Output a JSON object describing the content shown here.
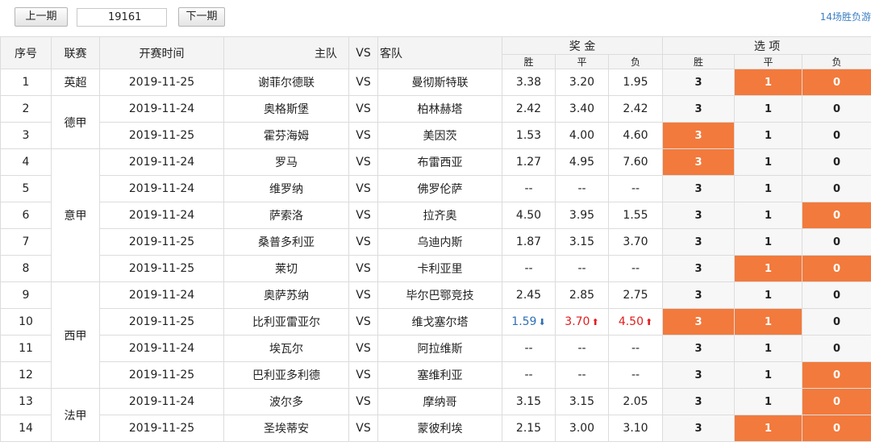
{
  "controls": {
    "prev_label": "上一期",
    "period_value": "19161",
    "next_label": "下一期",
    "top_link": "14场胜负游"
  },
  "headers": {
    "index": "序号",
    "league": "联赛",
    "time": "开赛时间",
    "home": "主队",
    "vs": "VS",
    "away": "客队",
    "prize_group": "奖 金",
    "options_group": "选 项",
    "win": "胜",
    "draw": "平",
    "lose": "负"
  },
  "colors": {
    "selected": "#f27a3c",
    "odds_down": "#2f6fb4",
    "odds_up": "#e21c1c"
  },
  "leagues": [
    {
      "name": "英超",
      "rows": 1
    },
    {
      "name": "德甲",
      "rows": 2
    },
    {
      "name": "意甲",
      "rows": 5
    },
    {
      "name": "西甲",
      "rows": 4
    },
    {
      "name": "法甲",
      "rows": 2
    }
  ],
  "matches": [
    {
      "no": "1",
      "date": "2019-11-25",
      "home": "谢菲尔德联",
      "vs": "VS",
      "away": "曼彻斯特联",
      "win": "3.38",
      "draw": "3.20",
      "lose": "1.95",
      "opt": [
        "3",
        "1",
        "0"
      ],
      "sel": [
        false,
        true,
        true
      ]
    },
    {
      "no": "2",
      "date": "2019-11-24",
      "home": "奥格斯堡",
      "vs": "VS",
      "away": "柏林赫塔",
      "win": "2.42",
      "draw": "3.40",
      "lose": "2.42",
      "opt": [
        "3",
        "1",
        "0"
      ],
      "sel": [
        false,
        false,
        false
      ]
    },
    {
      "no": "3",
      "date": "2019-11-25",
      "home": "霍芬海姆",
      "vs": "VS",
      "away": "美因茨",
      "win": "1.53",
      "draw": "4.00",
      "lose": "4.60",
      "opt": [
        "3",
        "1",
        "0"
      ],
      "sel": [
        true,
        false,
        false
      ]
    },
    {
      "no": "4",
      "date": "2019-11-24",
      "home": "罗马",
      "vs": "VS",
      "away": "布雷西亚",
      "win": "1.27",
      "draw": "4.95",
      "lose": "7.60",
      "opt": [
        "3",
        "1",
        "0"
      ],
      "sel": [
        true,
        false,
        false
      ]
    },
    {
      "no": "5",
      "date": "2019-11-24",
      "home": "维罗纳",
      "vs": "VS",
      "away": "佛罗伦萨",
      "win": "--",
      "draw": "--",
      "lose": "--",
      "opt": [
        "3",
        "1",
        "0"
      ],
      "sel": [
        false,
        false,
        false
      ]
    },
    {
      "no": "6",
      "date": "2019-11-24",
      "home": "萨索洛",
      "vs": "VS",
      "away": "拉齐奥",
      "win": "4.50",
      "draw": "3.95",
      "lose": "1.55",
      "opt": [
        "3",
        "1",
        "0"
      ],
      "sel": [
        false,
        false,
        true
      ]
    },
    {
      "no": "7",
      "date": "2019-11-25",
      "home": "桑普多利亚",
      "vs": "VS",
      "away": "乌迪内斯",
      "win": "1.87",
      "draw": "3.15",
      "lose": "3.70",
      "opt": [
        "3",
        "1",
        "0"
      ],
      "sel": [
        false,
        false,
        false
      ]
    },
    {
      "no": "8",
      "date": "2019-11-25",
      "home": "莱切",
      "vs": "VS",
      "away": "卡利亚里",
      "win": "--",
      "draw": "--",
      "lose": "--",
      "opt": [
        "3",
        "1",
        "0"
      ],
      "sel": [
        false,
        true,
        true
      ]
    },
    {
      "no": "9",
      "date": "2019-11-24",
      "home": "奥萨苏纳",
      "vs": "VS",
      "away": "毕尔巴鄂竞技",
      "win": "2.45",
      "draw": "2.85",
      "lose": "2.75",
      "opt": [
        "3",
        "1",
        "0"
      ],
      "sel": [
        false,
        false,
        false
      ]
    },
    {
      "no": "10",
      "date": "2019-11-25",
      "home": "比利亚雷亚尔",
      "vs": "VS",
      "away": "维戈塞尔塔",
      "win": "1.59",
      "draw": "3.70",
      "lose": "4.50",
      "opt": [
        "3",
        "1",
        "0"
      ],
      "sel": [
        true,
        true,
        false
      ],
      "trend": [
        "down",
        "up",
        "up"
      ]
    },
    {
      "no": "11",
      "date": "2019-11-24",
      "home": "埃瓦尔",
      "vs": "VS",
      "away": "阿拉维斯",
      "win": "--",
      "draw": "--",
      "lose": "--",
      "opt": [
        "3",
        "1",
        "0"
      ],
      "sel": [
        false,
        false,
        false
      ]
    },
    {
      "no": "12",
      "date": "2019-11-25",
      "home": "巴利亚多利德",
      "vs": "VS",
      "away": "塞维利亚",
      "win": "--",
      "draw": "--",
      "lose": "--",
      "opt": [
        "3",
        "1",
        "0"
      ],
      "sel": [
        false,
        false,
        true
      ]
    },
    {
      "no": "13",
      "date": "2019-11-24",
      "home": "波尔多",
      "vs": "VS",
      "away": "摩纳哥",
      "win": "3.15",
      "draw": "3.15",
      "lose": "2.05",
      "opt": [
        "3",
        "1",
        "0"
      ],
      "sel": [
        false,
        false,
        true
      ]
    },
    {
      "no": "14",
      "date": "2019-11-25",
      "home": "圣埃蒂安",
      "vs": "VS",
      "away": "蒙彼利埃",
      "win": "2.15",
      "draw": "3.00",
      "lose": "3.10",
      "opt": [
        "3",
        "1",
        "0"
      ],
      "sel": [
        false,
        true,
        true
      ]
    }
  ]
}
